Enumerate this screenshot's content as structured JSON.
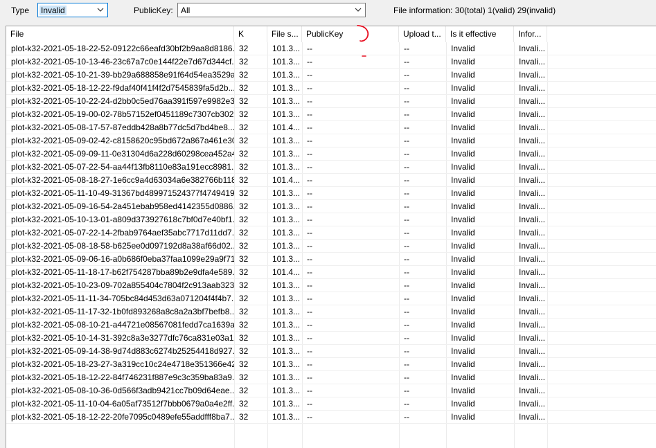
{
  "toolbar": {
    "type_label": "Type",
    "type_value": "Invalid",
    "publickey_label": "PublicKey:",
    "publickey_value": "All",
    "file_information": "File information: 30(total) 1(valid) 29(invalid)"
  },
  "table": {
    "columns": [
      "File",
      "K",
      "File s...",
      "PublicKey",
      "Upload t...",
      "Is it effective",
      "Infor..."
    ],
    "rows": [
      [
        "plot-k32-2021-05-18-22-52-09122c66eafd30bf2b9aa8d8186...",
        "32",
        "101.3...",
        "--",
        "--",
        "Invalid",
        "Invali..."
      ],
      [
        "plot-k32-2021-05-10-13-46-23c67a7c0e144f22e7d67d344cf...",
        "32",
        "101.3...",
        "--",
        "--",
        "Invalid",
        "Invali..."
      ],
      [
        "plot-k32-2021-05-10-21-39-bb29a688858e91f64d54ea3529a...",
        "32",
        "101.3...",
        "--",
        "--",
        "Invalid",
        "Invali..."
      ],
      [
        "plot-k32-2021-05-18-12-22-f9daf40f41f4f2d7545839fa5d2b...",
        "32",
        "101.3...",
        "--",
        "--",
        "Invalid",
        "Invali..."
      ],
      [
        "plot-k32-2021-05-10-22-24-d2bb0c5ed76aa391f597e9982e3...",
        "32",
        "101.3...",
        "--",
        "--",
        "Invalid",
        "Invali..."
      ],
      [
        "plot-k32-2021-05-19-00-02-78b57152ef0451189c7307cb302...",
        "32",
        "101.3...",
        "--",
        "--",
        "Invalid",
        "Invali..."
      ],
      [
        "plot-k32-2021-05-08-17-57-87eddb428a8b77dc5d7bd4be8...",
        "32",
        "101.4...",
        "--",
        "--",
        "Invalid",
        "Invali..."
      ],
      [
        "plot-k32-2021-05-09-02-42-c8158620c95bd672a867a461e30...",
        "32",
        "101.3...",
        "--",
        "--",
        "Invalid",
        "Invali..."
      ],
      [
        "plot-k32-2021-05-09-09-11-0e31304d6a228d60298cea452a4...",
        "32",
        "101.3...",
        "--",
        "--",
        "Invalid",
        "Invali..."
      ],
      [
        "plot-k32-2021-05-07-22-54-aa44f13fb8110e83a191ecc8981...",
        "32",
        "101.3...",
        "--",
        "--",
        "Invalid",
        "Invali..."
      ],
      [
        "plot-k32-2021-05-08-18-27-1e6cc9a4d63034a6e382766b118...",
        "32",
        "101.4...",
        "--",
        "--",
        "Invalid",
        "Invali..."
      ],
      [
        "plot-k32-2021-05-11-10-49-31367bd489971524377f4749419...",
        "32",
        "101.3...",
        "--",
        "--",
        "Invalid",
        "Invali..."
      ],
      [
        "plot-k32-2021-05-09-16-54-2a451ebab958ed4142355d0886...",
        "32",
        "101.3...",
        "--",
        "--",
        "Invalid",
        "Invali..."
      ],
      [
        "plot-k32-2021-05-10-13-01-a809d373927618c7bf0d7e40bf1...",
        "32",
        "101.3...",
        "--",
        "--",
        "Invalid",
        "Invali..."
      ],
      [
        "plot-k32-2021-05-07-22-14-2fbab9764aef35abc7717d11dd7...",
        "32",
        "101.3...",
        "--",
        "--",
        "Invalid",
        "Invali..."
      ],
      [
        "plot-k32-2021-05-08-18-58-b625ee0d097192d8a38af66d02...",
        "32",
        "101.3...",
        "--",
        "--",
        "Invalid",
        "Invali..."
      ],
      [
        "plot-k32-2021-05-09-06-16-a0b686f0eba37faa1099e29a9f71...",
        "32",
        "101.3...",
        "--",
        "--",
        "Invalid",
        "Invali..."
      ],
      [
        "plot-k32-2021-05-11-18-17-b62f754287bba89b2e9dfa4e589...",
        "32",
        "101.4...",
        "--",
        "--",
        "Invalid",
        "Invali..."
      ],
      [
        "plot-k32-2021-05-10-23-09-702a855404c7804f2c913aab323...",
        "32",
        "101.3...",
        "--",
        "--",
        "Invalid",
        "Invali..."
      ],
      [
        "plot-k32-2021-05-11-11-34-705bc84d453d63a071204f4f4b7...",
        "32",
        "101.3...",
        "--",
        "--",
        "Invalid",
        "Invali..."
      ],
      [
        "plot-k32-2021-05-11-17-32-1b0fd893268a8c8a2a3bf7befb8...",
        "32",
        "101.3...",
        "--",
        "--",
        "Invalid",
        "Invali..."
      ],
      [
        "plot-k32-2021-05-08-10-21-a44721e08567081fedd7ca1639a...",
        "32",
        "101.3...",
        "--",
        "--",
        "Invalid",
        "Invali..."
      ],
      [
        "plot-k32-2021-05-10-14-31-392c8a3e3277dfc76ca831e03a1...",
        "32",
        "101.3...",
        "--",
        "--",
        "Invalid",
        "Invali..."
      ],
      [
        "plot-k32-2021-05-09-14-38-9d74d883c6274b25254418d927...",
        "32",
        "101.3...",
        "--",
        "--",
        "Invalid",
        "Invali..."
      ],
      [
        "plot-k32-2021-05-18-23-27-3a319cc10c24e4718e351366e42...",
        "32",
        "101.3...",
        "--",
        "--",
        "Invalid",
        "Invali..."
      ],
      [
        "plot-k32-2021-05-18-12-22-84f746231f887e9c3c359ba83a9...",
        "32",
        "101.3...",
        "--",
        "--",
        "Invalid",
        "Invali..."
      ],
      [
        "plot-k32-2021-05-08-10-36-0d566f3adb9421cc7b09d64eae...",
        "32",
        "101.3...",
        "--",
        "--",
        "Invalid",
        "Invali..."
      ],
      [
        "plot-k32-2021-05-11-10-04-6a05af73512f7bbb0679a0a4e2ff...",
        "32",
        "101.3...",
        "--",
        "--",
        "Invalid",
        "Invali..."
      ],
      [
        "plot-k32-2021-05-18-12-22-20fe7095c0489efe55addfff8ba7...",
        "32",
        "101.3...",
        "--",
        "--",
        "Invalid",
        "Invali..."
      ]
    ]
  },
  "icons": {
    "dropdown": "chevron-down-icon",
    "annotation": "red-scribble-mark"
  },
  "colors": {
    "focus_border": "#0078d7",
    "selection": "#cce4f7",
    "annotation": "#e81123"
  }
}
